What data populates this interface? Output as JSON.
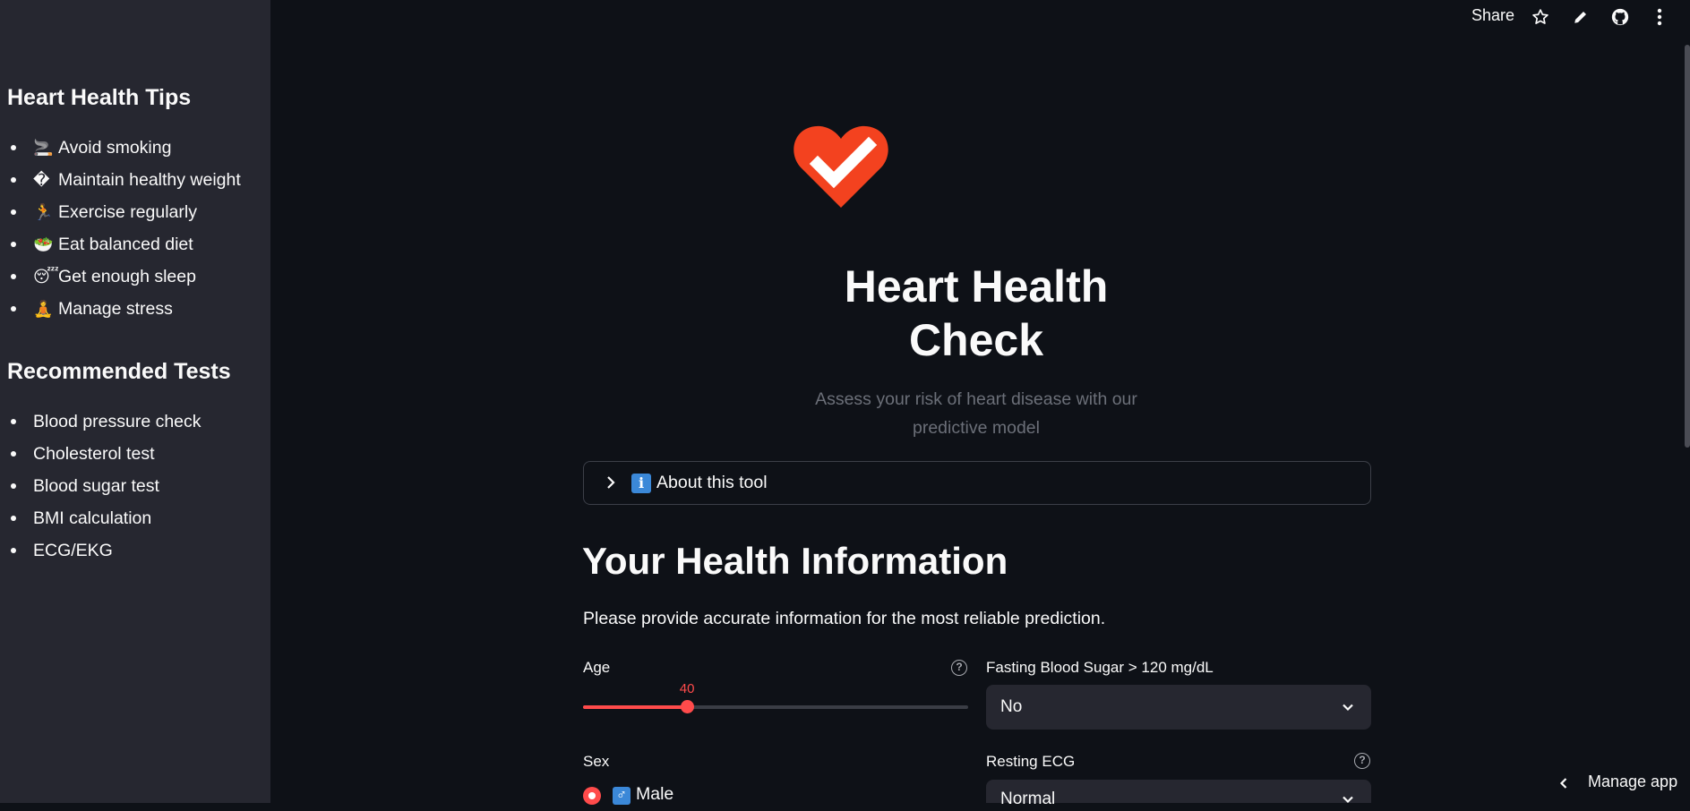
{
  "sidebar": {
    "tips_heading": "Heart Health Tips",
    "tips": [
      {
        "icon": "🚬",
        "label": "Avoid smoking"
      },
      {
        "icon": "�",
        "label": "Maintain healthy weight"
      },
      {
        "icon": "🏃",
        "label": "Exercise regularly"
      },
      {
        "icon": "🥗",
        "label": "Eat balanced diet"
      },
      {
        "icon": "😴",
        "label": "Get enough sleep"
      },
      {
        "icon": "🧘",
        "label": "Manage stress"
      }
    ],
    "tests_heading": "Recommended Tests",
    "tests": [
      "Blood pressure check",
      "Cholesterol test",
      "Blood sugar test",
      "BMI calculation",
      "ECG/EKG"
    ]
  },
  "toolbar": {
    "share_label": "Share",
    "icons": [
      "star-icon",
      "edit-icon",
      "github-icon",
      "more-vert-icon"
    ]
  },
  "hero": {
    "logo": "heart-check-icon",
    "title_line1": "Heart Health",
    "title_line2": "Check",
    "subtitle_line1": "Assess your risk of heart disease with our",
    "subtitle_line2": "predictive model"
  },
  "about": {
    "icon": "i",
    "label": "About this tool"
  },
  "form": {
    "heading": "Your Health Information",
    "subheading": "Please provide accurate information for the most reliable prediction.",
    "age": {
      "label": "Age",
      "value": "40",
      "fraction": 0.27
    },
    "fasting_blood_sugar": {
      "label": "Fasting Blood Sugar > 120 mg/dL",
      "value": "No"
    },
    "sex": {
      "label": "Sex",
      "option_icon": "♂",
      "option_label": "Male"
    },
    "resting_ecg": {
      "label": "Resting ECG",
      "value": "Normal"
    }
  },
  "footer": {
    "manage_label": "Manage app"
  },
  "colors": {
    "accent": "#ff4b4b",
    "background": "#0e1117",
    "sidebar": "#262730",
    "logo": "#f3421f"
  }
}
